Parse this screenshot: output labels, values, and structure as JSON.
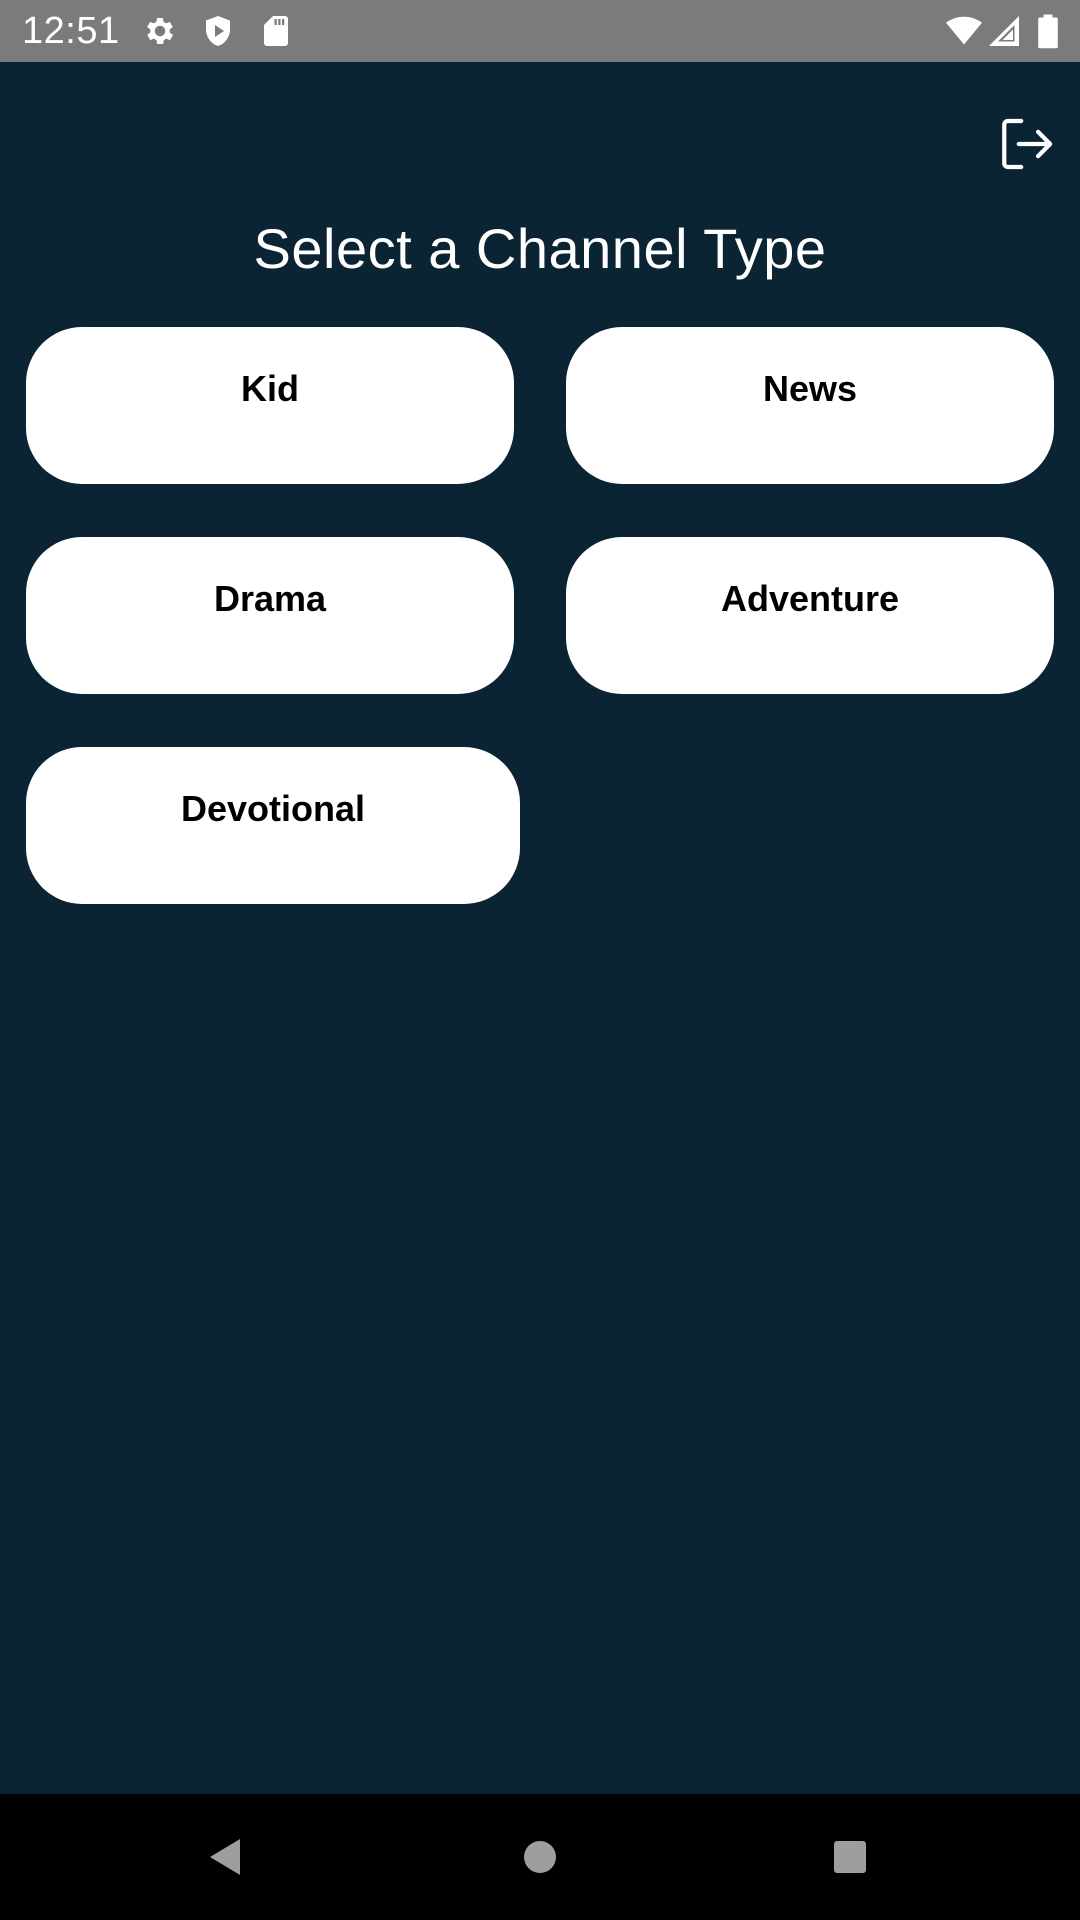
{
  "status_bar": {
    "time": "12:51",
    "left_icons": [
      "settings-icon",
      "shield-play-icon",
      "sd-card-icon"
    ],
    "right_icons": [
      "wifi-icon",
      "cell-signal-icon",
      "battery-icon"
    ]
  },
  "header": {
    "title": "Select a Channel Type",
    "exit_icon": "logout-icon"
  },
  "channels": [
    {
      "label": "Kid"
    },
    {
      "label": "News"
    },
    {
      "label": "Drama"
    },
    {
      "label": "Adventure"
    },
    {
      "label": "Devotional"
    }
  ],
  "nav_bar": {
    "buttons": [
      "back-icon",
      "home-icon",
      "recents-icon"
    ]
  },
  "colors": {
    "background": "#0b2433",
    "status_bar": "#7b7b7b",
    "button": "#ffffff",
    "nav_bar": "#000000",
    "nav_icon": "#9e9e9e"
  }
}
